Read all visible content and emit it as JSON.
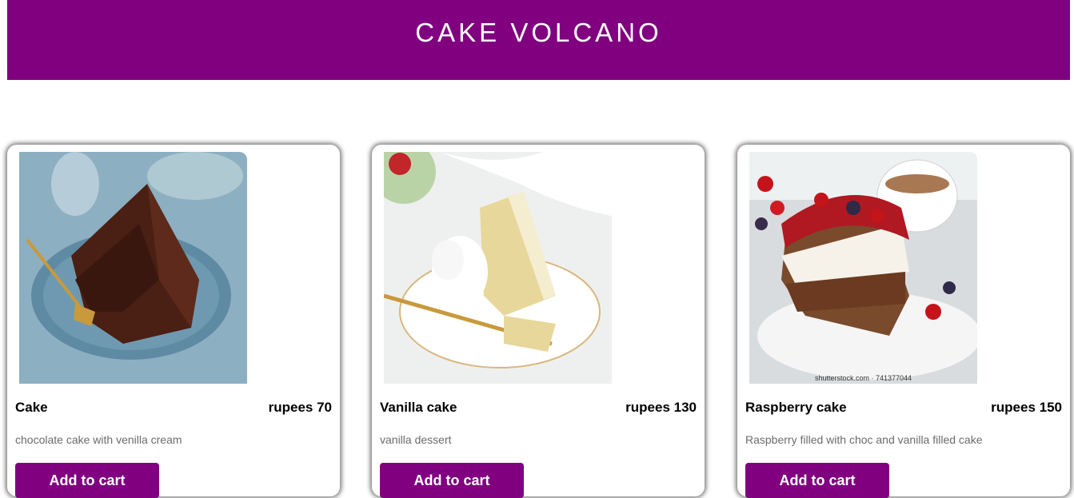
{
  "header": {
    "title": "CAKE VOLCANO",
    "background": "#800080"
  },
  "products": [
    {
      "name": "Cake",
      "price": "rupees 70",
      "description": "chocolate cake with venilla cream",
      "button_label": "Add to cart",
      "image_icon": "chocolate-cake-photo"
    },
    {
      "name": "Vanilla cake",
      "price": "rupees 130",
      "description": "vanilla dessert",
      "button_label": "Add to cart",
      "image_icon": "vanilla-cake-photo"
    },
    {
      "name": "Raspberry cake",
      "price": "rupees 150",
      "description": "Raspberry filled with choc and vanilla filled cake",
      "button_label": "Add to cart",
      "image_icon": "raspberry-cake-photo",
      "image_watermark": "shutterstock.com · 741377044"
    }
  ],
  "colors": {
    "accent": "#800080",
    "description_text": "#6b6b6b"
  }
}
